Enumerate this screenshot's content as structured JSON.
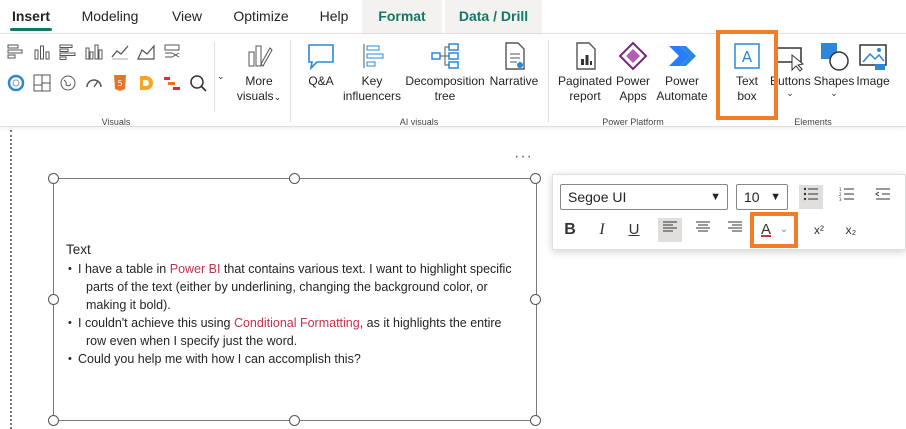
{
  "tabs": [
    "Insert",
    "Modeling",
    "View",
    "Optimize",
    "Help",
    "Format",
    "Data / Drill"
  ],
  "ribbon": {
    "groups": {
      "visuals": "Visuals",
      "ai_visuals": "AI visuals",
      "power_platform": "Power Platform",
      "elements": "Elements"
    },
    "more_visuals": [
      "More",
      "visuals"
    ],
    "qa": "Q&A",
    "key_influencers": [
      "Key",
      "influencers"
    ],
    "decomposition_tree": [
      "Decomposition",
      "tree"
    ],
    "narrative": "Narrative",
    "paginated_report": [
      "Paginated",
      "report"
    ],
    "power_apps": [
      "Power",
      "Apps"
    ],
    "power_automate": [
      "Power",
      "Automate"
    ],
    "text_box": [
      "Text",
      "box"
    ],
    "buttons": "Buttons",
    "shapes": "Shapes",
    "image": "Image"
  },
  "textbox": {
    "title": "Text",
    "bullets": [
      {
        "before": "I have a table in ",
        "link": "Power BI",
        "after": " that contains various text. I want to highlight specific parts of the text (either by underlining, changing the background color, or making it bold)."
      },
      {
        "before": "I couldn't achieve this using ",
        "link": "Conditional Formatting",
        "after": ", as it highlights the entire row even when I specify just the word."
      },
      {
        "before": "Could you help me with how I can accomplish this?",
        "link": "",
        "after": ""
      }
    ]
  },
  "format_toolbar": {
    "font": "Segoe UI",
    "size": "10",
    "bold": "B",
    "italic": "I",
    "underline": "U",
    "font_color": "A",
    "superscript": "x²",
    "subscript": "x₂"
  },
  "colors": {
    "accent": "#117865",
    "highlight_box": "#f07d2a",
    "link_text": "#c4314b"
  }
}
